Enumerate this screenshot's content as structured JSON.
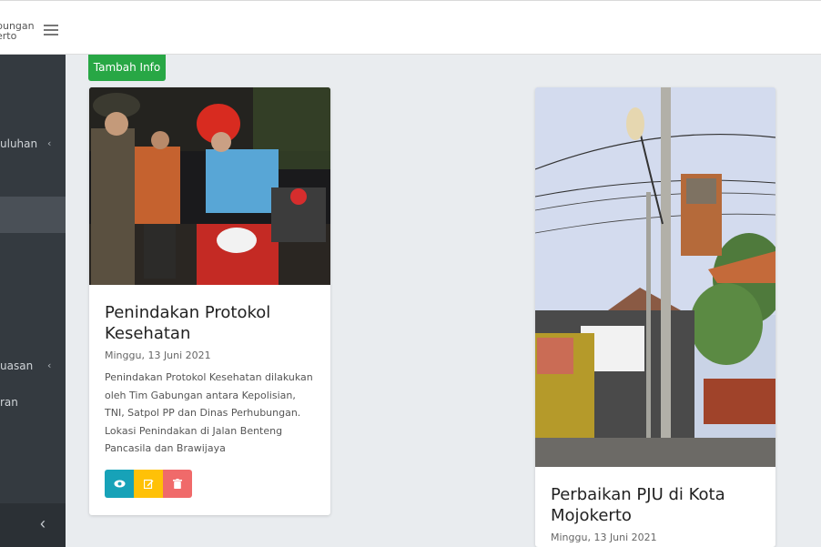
{
  "header": {
    "brand_line1": "bungan",
    "brand_line2": "erto",
    "menu_icon": "hamburger-icon"
  },
  "sidebar": {
    "items": [
      {
        "label": "uluhan",
        "has_chevron": true,
        "chevron": "‹"
      },
      {
        "label": "uasan",
        "has_chevron": true,
        "chevron": "‹"
      },
      {
        "label": "ran",
        "has_chevron": false
      }
    ],
    "collapse_icon": "‹"
  },
  "main": {
    "add_button_label": "Tambah Info",
    "cards": [
      {
        "title": "Penindakan Protokol Kesehatan",
        "date": "Minggu, 13 Juni 2021",
        "text": "Penindakan Protokol Kesehatan dilakukan oleh Tim Gabungan antara Kepolisian, TNI, Satpol PP dan Dinas Perhubungan. Lokasi Penindakan di Jalan Benteng Pancasila dan Brawijaya"
      },
      {
        "title": "Perbaikan PJU di Kota Mojokerto",
        "date": "Minggu, 13 Juni 2021"
      }
    ]
  },
  "colors": {
    "sidebar_bg": "#343a40",
    "add_button": "#28a745",
    "view_button": "#17a2b8",
    "edit_button": "#ffc107",
    "delete_button": "#f06a6a"
  }
}
